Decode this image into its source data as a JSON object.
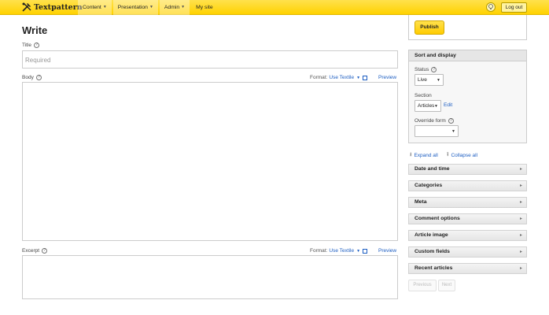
{
  "topbar": {
    "brand": "Textpattern",
    "nav": [
      {
        "label": "Content",
        "dropdown": true
      },
      {
        "label": "Presentation",
        "dropdown": true
      },
      {
        "label": "Admin",
        "dropdown": true
      },
      {
        "label": "My site",
        "dropdown": false
      }
    ],
    "logout_label": "Log out"
  },
  "main": {
    "title": "Write",
    "title_label": "Title",
    "title_placeholder": "Required",
    "body_label": "Body",
    "excerpt_label": "Excerpt",
    "format_prefix": "Format:",
    "format_value": "Use Textile",
    "preview_label": "Preview",
    "help_glyph": "?"
  },
  "sidebar": {
    "publish_label": "Publish",
    "sort_header": "Sort and display",
    "status_label": "Status",
    "status_value": "Live",
    "section_label": "Section",
    "section_value": "Articles",
    "edit_label": "Edit",
    "override_label": "Override form",
    "override_value": "",
    "expand_all": "Expand all",
    "collapse_all": "Collapse all",
    "panels": [
      "Date and time",
      "Categories",
      "Meta",
      "Comment options",
      "Article image",
      "Custom fields",
      "Recent articles"
    ],
    "previous_label": "Previous",
    "next_label": "Next"
  },
  "colors": {
    "accent": "#ffd200",
    "link": "#1d5ec2"
  }
}
